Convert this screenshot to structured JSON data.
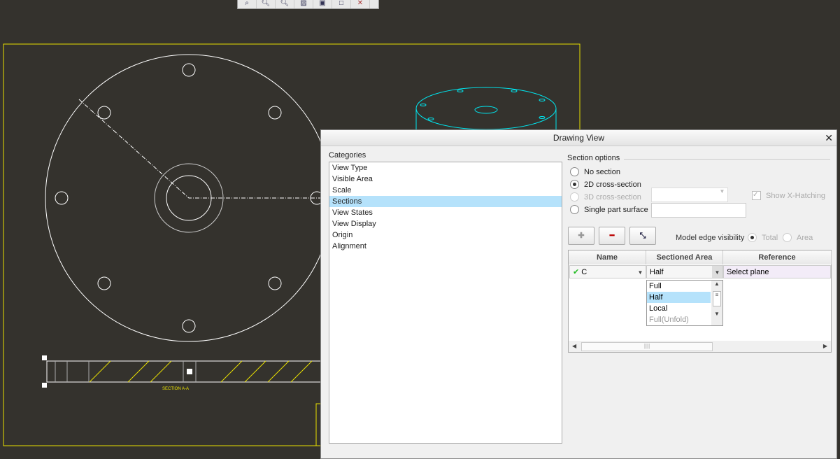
{
  "toolbar": {
    "icons": [
      "zoom-fit-icon",
      "zoom-in-icon",
      "zoom-out-icon",
      "repaint-icon",
      "display-style-icon",
      "view-manager-icon",
      "datum-display-icon"
    ]
  },
  "drawing": {
    "section_label": "SECTION A-A",
    "border_color": "#e8e000",
    "geometry_color": "#ffffff",
    "model_color": "#00e5ee"
  },
  "dialog": {
    "title": "Drawing View",
    "categories_label": "Categories",
    "categories": [
      "View Type",
      "Visible Area",
      "Scale",
      "Sections",
      "View States",
      "View Display",
      "Origin",
      "Alignment"
    ],
    "selected_category": "Sections",
    "section_options_label": "Section options",
    "options": [
      {
        "label": "No section",
        "checked": false,
        "enabled": true
      },
      {
        "label": "2D cross-section",
        "checked": true,
        "enabled": true
      },
      {
        "label": "3D cross-section",
        "checked": false,
        "enabled": false
      },
      {
        "label": "Single part surface",
        "checked": false,
        "enabled": true
      }
    ],
    "show_xhatching": {
      "label": "Show X-Hatching",
      "checked": true,
      "enabled": false
    },
    "model_edge_visibility": {
      "label": "Model edge visibility",
      "options": [
        "Total",
        "Area"
      ],
      "selected": "Total"
    },
    "table": {
      "headers": [
        "Name",
        "Sectioned Area",
        "Reference"
      ],
      "row": {
        "name": "C",
        "status": "check",
        "area": "Half",
        "reference": "Select plane"
      }
    },
    "area_options": [
      "Full",
      "Half",
      "Local",
      "Full(Unfold)"
    ],
    "area_selected": "Half",
    "accent": "#b5e2fb"
  }
}
